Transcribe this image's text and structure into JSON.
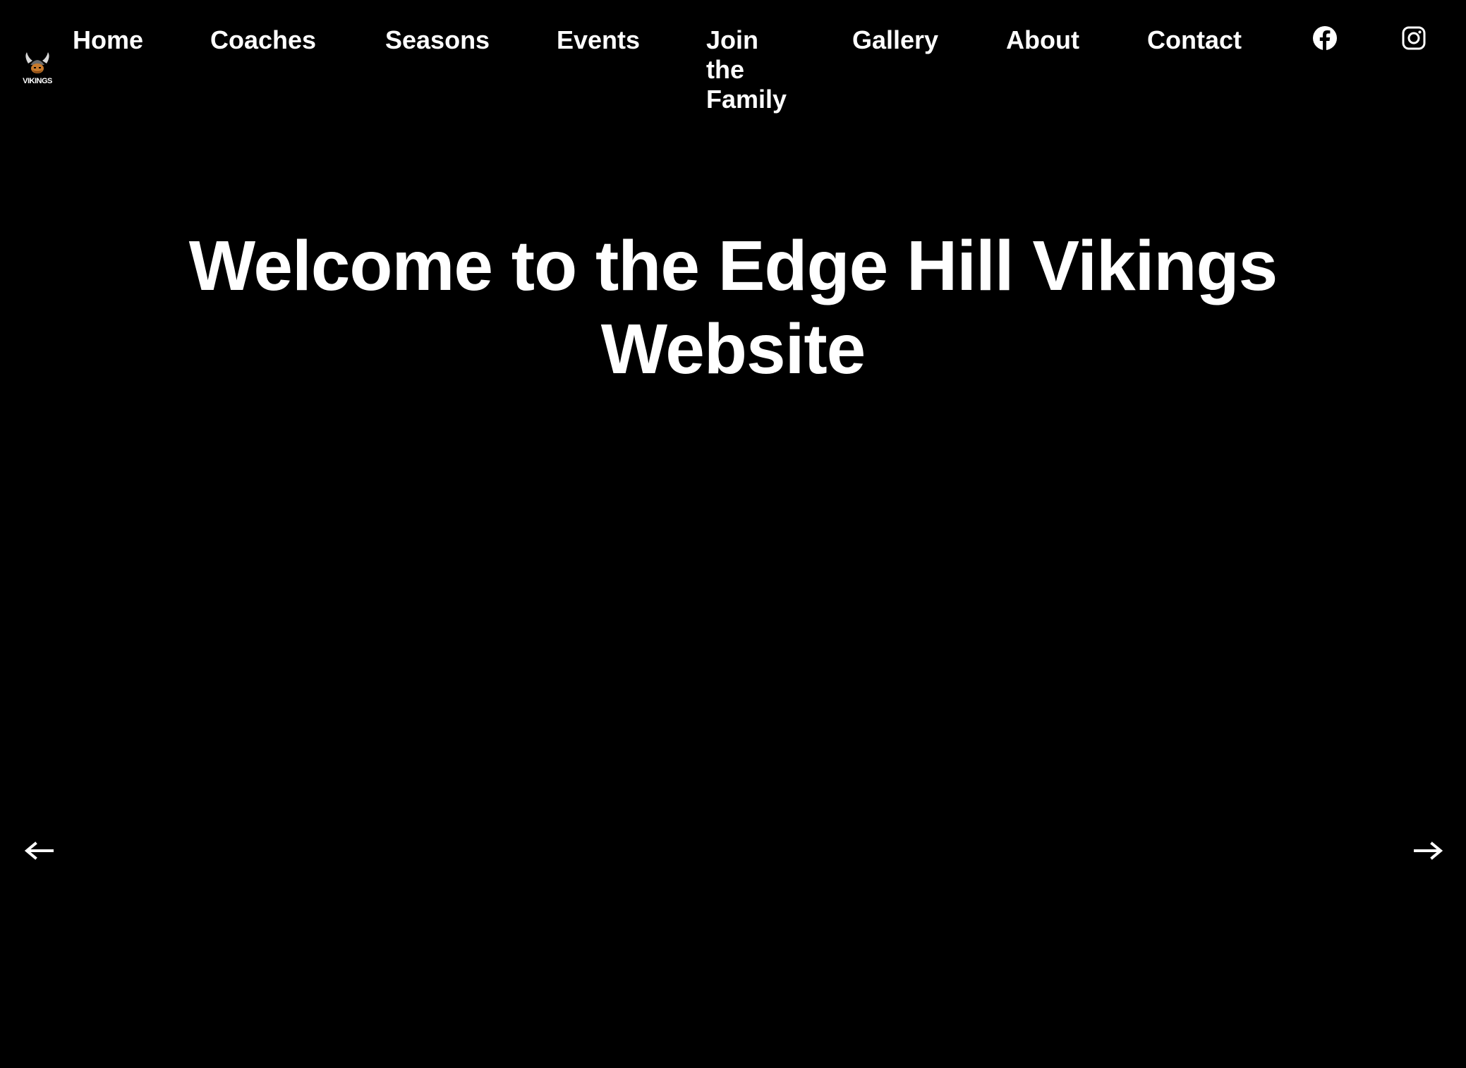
{
  "brand": {
    "logo_icon": "vikings-logo",
    "logo_text": "VIKINGS"
  },
  "nav": {
    "items": [
      {
        "label": "Home"
      },
      {
        "label": "Coaches"
      },
      {
        "label": "Seasons"
      },
      {
        "label": "Events"
      },
      {
        "label": "Join the Family"
      },
      {
        "label": "Gallery"
      },
      {
        "label": "About"
      },
      {
        "label": "Contact"
      }
    ],
    "social": [
      {
        "icon": "facebook-icon"
      },
      {
        "icon": "instagram-icon"
      }
    ]
  },
  "hero": {
    "title": "Welcome to the Edge Hill Vikings Website"
  },
  "carousel": {
    "prev_icon": "arrow-left-icon",
    "next_icon": "arrow-right-icon"
  },
  "colors": {
    "background": "#000000",
    "text": "#ffffff"
  }
}
